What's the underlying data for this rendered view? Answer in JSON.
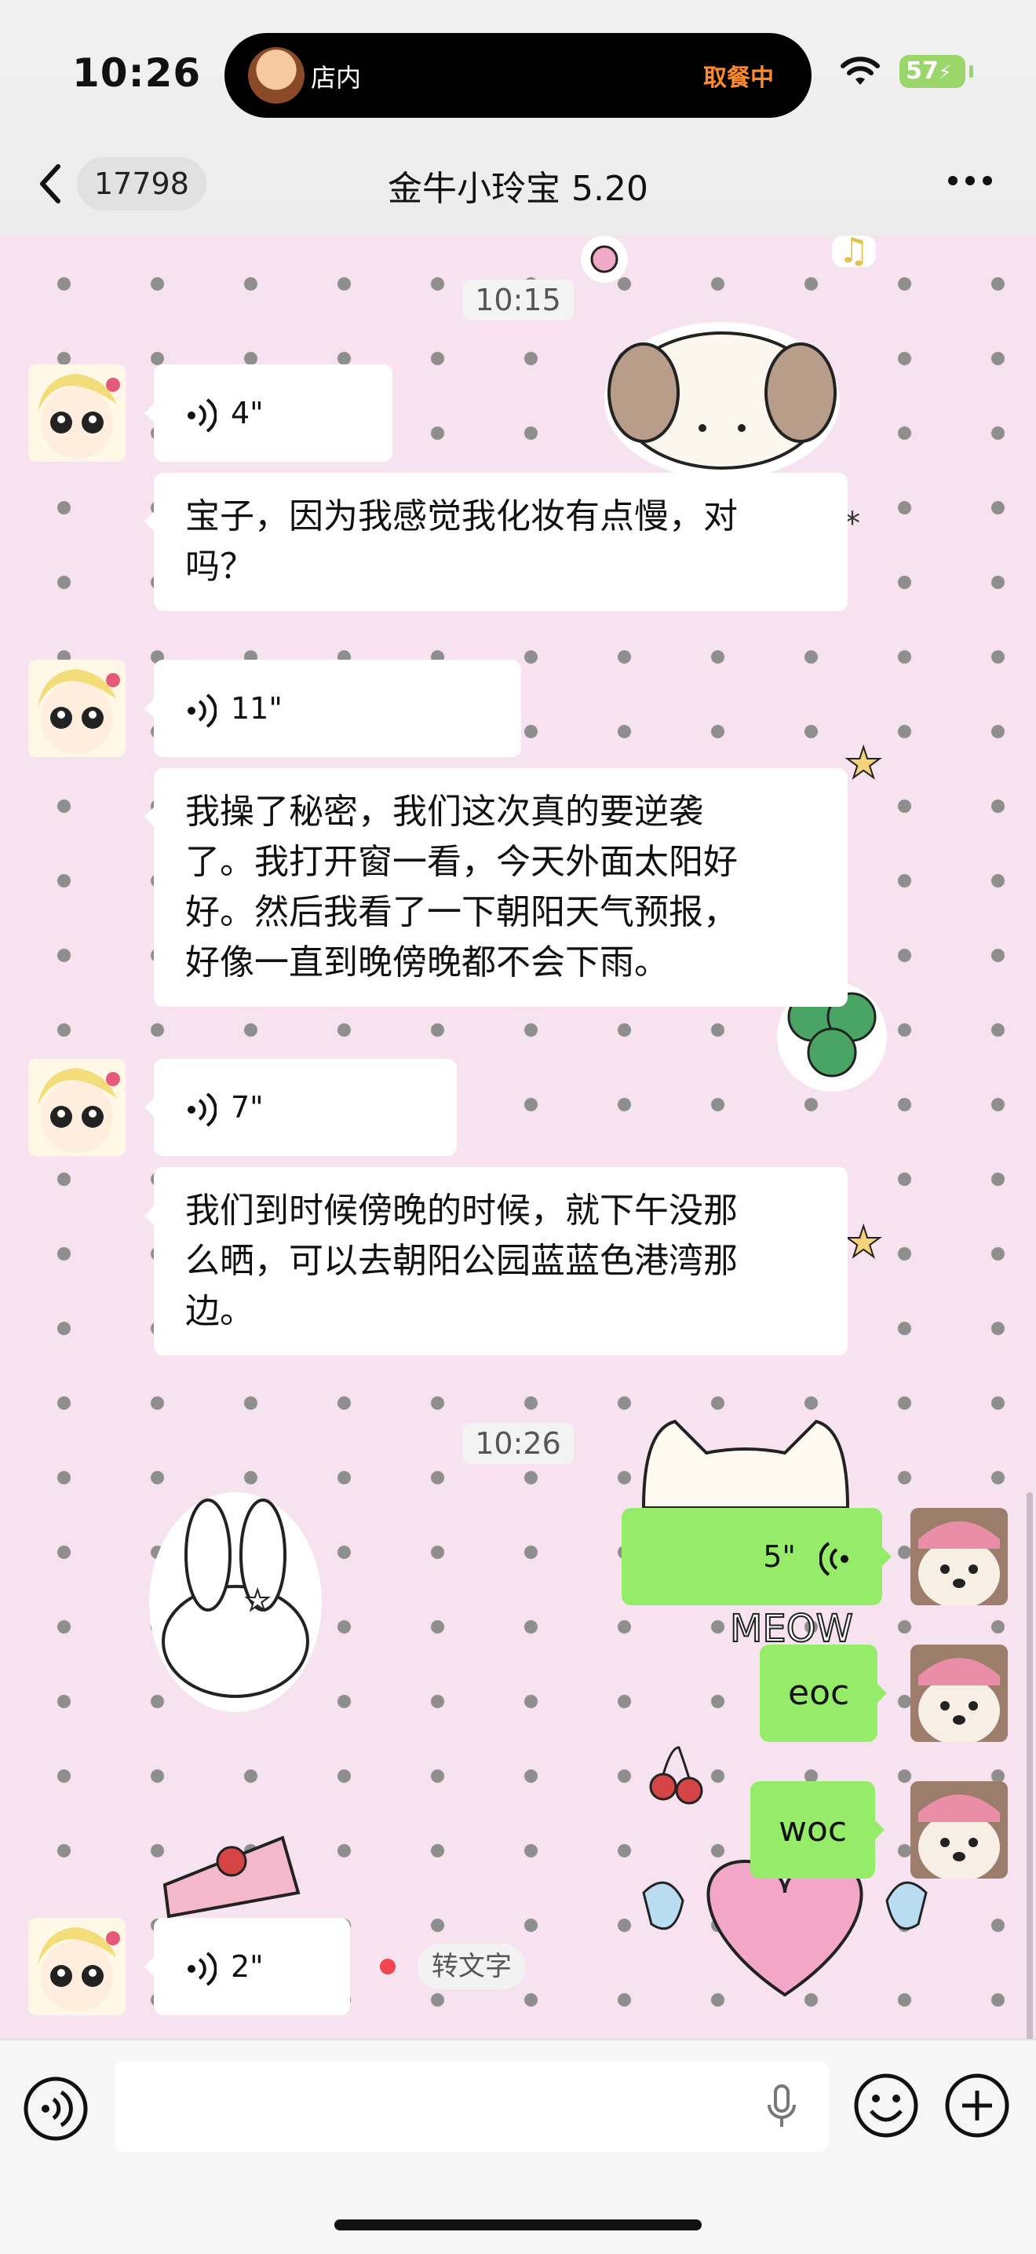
{
  "status_bar": {
    "time": "10:26",
    "shop_label": "店内",
    "pickup_label": "取餐中",
    "battery": "57"
  },
  "nav": {
    "unread_count": "17798",
    "title": "金牛小玲宝 5.20"
  },
  "chat": {
    "timestamps": [
      "10:15",
      "10:26"
    ],
    "messages": [
      {
        "from": "contact",
        "type": "voice",
        "duration": "4\""
      },
      {
        "from": "contact",
        "type": "text",
        "lines": [
          "宝子，因为我感觉我化妆有点慢，对",
          "吗？"
        ]
      },
      {
        "from": "contact",
        "type": "voice",
        "duration": "11\""
      },
      {
        "from": "contact",
        "type": "text",
        "lines": [
          "我操了秘密，我们这次真的要逆袭",
          "了。我打开窗一看，今天外面太阳好",
          "好。然后我看了一下朝阳天气预报，",
          "好像一直到晚傍晚都不会下雨。"
        ]
      },
      {
        "from": "contact",
        "type": "voice",
        "duration": "7\""
      },
      {
        "from": "contact",
        "type": "text",
        "lines": [
          "我们到时候傍晚的时候，就下午没那",
          "么晒，可以去朝阳公园蓝蓝色港湾那",
          "边。"
        ]
      },
      {
        "from": "me",
        "type": "voice",
        "duration": "5\""
      },
      {
        "from": "me",
        "type": "text",
        "text": "eoc"
      },
      {
        "from": "me",
        "type": "text",
        "text": "woc"
      },
      {
        "from": "contact",
        "type": "voice",
        "duration": "2\"",
        "action": "转文字"
      }
    ],
    "sticker_text": "MEOW"
  },
  "colors": {
    "my_bubble": "#95ec69",
    "wallpaper": "#f7e3ef",
    "unread_dot": "#f1454f",
    "pickup": "#ff8a2b"
  },
  "icons": [
    "back-icon",
    "more-icon",
    "voice-icon",
    "mic-icon",
    "emoji-icon",
    "plus-icon",
    "wifi-icon"
  ]
}
